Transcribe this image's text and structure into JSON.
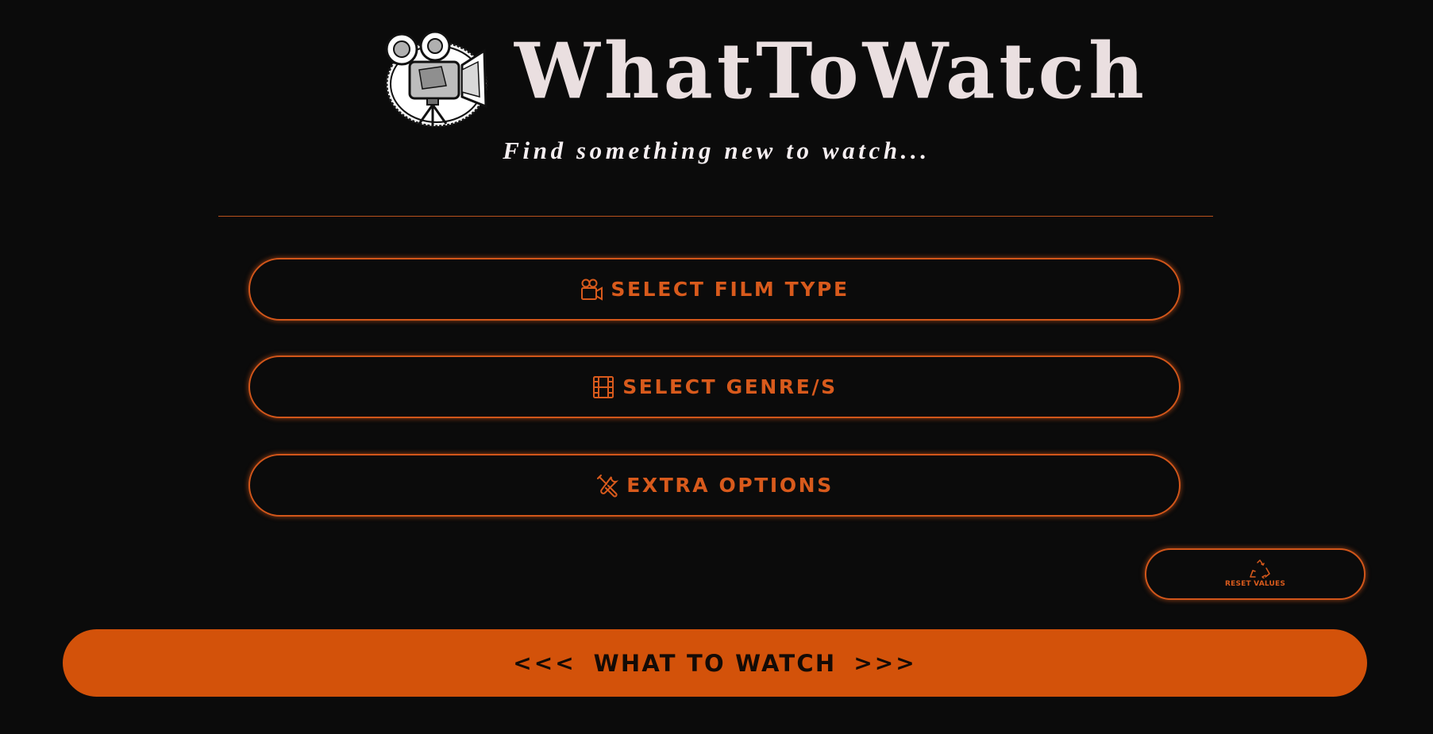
{
  "header": {
    "title": "WhatToWatch",
    "tagline": "Find something new to watch...",
    "logo_icon": "movie-camera-logo"
  },
  "options": [
    {
      "label": "SELECT FILM TYPE",
      "icon": "video-camera-icon"
    },
    {
      "label": "SELECT GENRE/S",
      "icon": "film-strip-icon"
    },
    {
      "label": "EXTRA OPTIONS",
      "icon": "tools-icon"
    }
  ],
  "reset": {
    "label": "RESET VALUES",
    "icon": "recycle-icon"
  },
  "watch": {
    "label": "WHAT TO WATCH",
    "left_arrows": "<<<",
    "right_arrows": ">>>"
  },
  "colors": {
    "background": "#0b0b0b",
    "accent": "#d3520a",
    "title": "#eadfe0",
    "tagline": "#f4eef0",
    "button_text_dark": "#140b06"
  }
}
